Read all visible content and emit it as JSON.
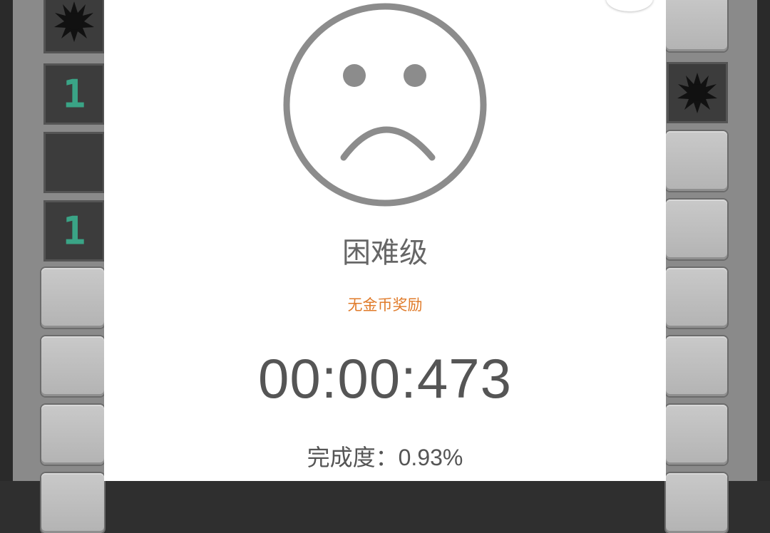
{
  "board": {
    "left_column": [
      {
        "state": "open",
        "content": "mine"
      },
      {
        "state": "open",
        "content": "1"
      },
      {
        "state": "open",
        "content": ""
      },
      {
        "state": "open",
        "content": "1"
      },
      {
        "state": "covered",
        "content": ""
      },
      {
        "state": "covered",
        "content": ""
      },
      {
        "state": "covered",
        "content": ""
      },
      {
        "state": "covered",
        "content": ""
      }
    ],
    "right_column": [
      {
        "state": "covered",
        "content": ""
      },
      {
        "state": "open",
        "content": "mine"
      },
      {
        "state": "covered",
        "content": ""
      },
      {
        "state": "covered",
        "content": ""
      },
      {
        "state": "covered",
        "content": ""
      },
      {
        "state": "covered",
        "content": ""
      },
      {
        "state": "covered",
        "content": ""
      },
      {
        "state": "covered",
        "content": ""
      }
    ],
    "number_color": "#3aa486"
  },
  "result_dialog": {
    "face_icon": "sad-face-icon",
    "difficulty": "困难级",
    "reward_text": "无金币奖励",
    "reward_color": "#e07b2a",
    "time": "00:00:473",
    "completion": "完成度：0.93%"
  }
}
